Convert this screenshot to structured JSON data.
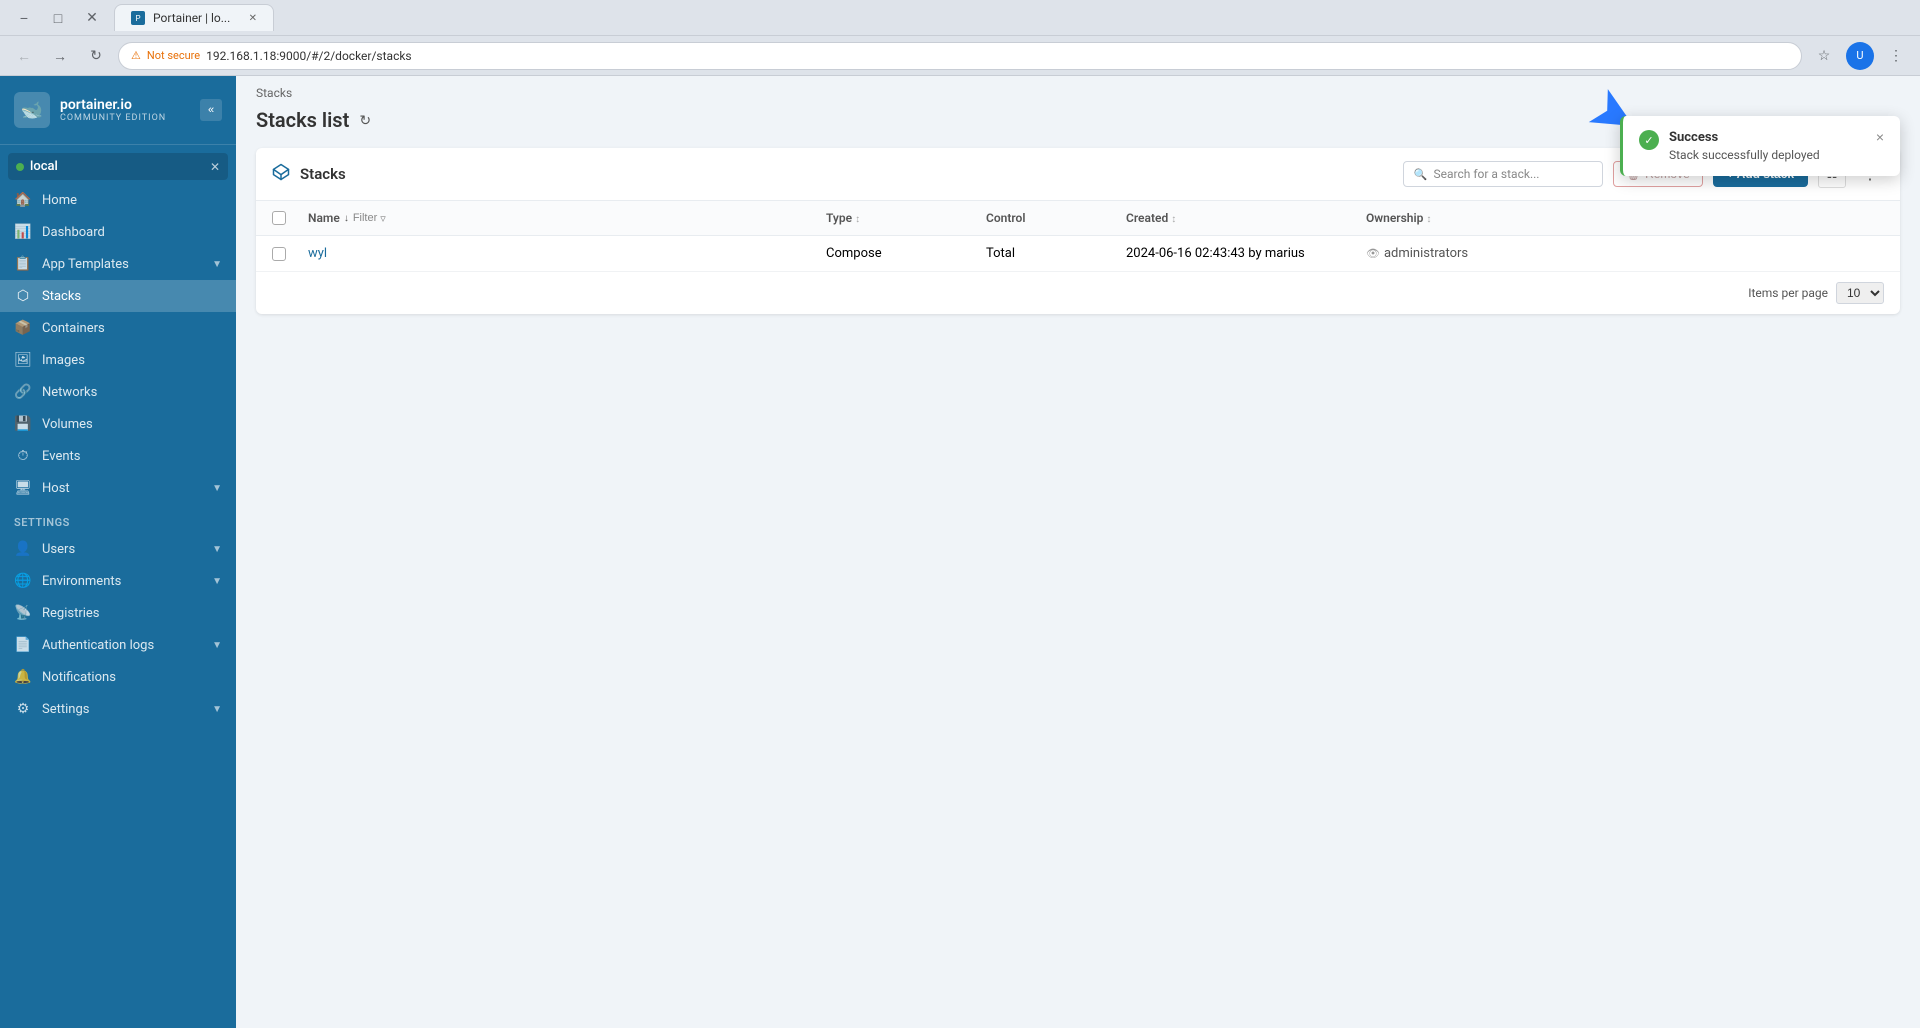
{
  "browser": {
    "tab_title": "Portainer | lo...",
    "tab_favicon": "P",
    "url": "192.168.1.18:9000/#/2/docker/stacks",
    "secure_label": "Not secure"
  },
  "sidebar": {
    "logo_text": "portainer.io",
    "logo_subtitle": "COMMUNITY EDITION",
    "env_name": "local",
    "nav_items": [
      {
        "icon": "🏠",
        "label": "Home"
      },
      {
        "icon": "📊",
        "label": "Dashboard"
      },
      {
        "icon": "📋",
        "label": "App Templates",
        "has_chevron": true
      },
      {
        "icon": "⬡",
        "label": "Stacks",
        "active": true
      },
      {
        "icon": "📦",
        "label": "Containers"
      },
      {
        "icon": "🖼",
        "label": "Images"
      },
      {
        "icon": "🔗",
        "label": "Networks"
      },
      {
        "icon": "💾",
        "label": "Volumes"
      },
      {
        "icon": "⏱",
        "label": "Events"
      },
      {
        "icon": "🖥",
        "label": "Host",
        "has_chevron": true
      }
    ],
    "settings_label": "Settings",
    "settings_items": [
      {
        "icon": "👤",
        "label": "Users",
        "has_chevron": true
      },
      {
        "icon": "🌐",
        "label": "Environments",
        "has_chevron": true
      },
      {
        "icon": "📡",
        "label": "Registries"
      },
      {
        "icon": "📄",
        "label": "Authentication logs",
        "has_chevron": true
      },
      {
        "icon": "🔔",
        "label": "Notifications"
      },
      {
        "icon": "⚙",
        "label": "Settings",
        "has_chevron": true
      }
    ]
  },
  "main": {
    "breadcrumb": "Stacks",
    "page_title": "Stacks list",
    "panel": {
      "title": "Stacks",
      "search_placeholder": "Search for a stack...",
      "remove_label": "Remove",
      "add_stack_label": "+ Add stack",
      "table": {
        "columns": [
          "Name",
          "Type",
          "Control",
          "Created",
          "Ownership"
        ],
        "rows": [
          {
            "name": "wyl",
            "type": "Compose",
            "control": "Total",
            "created": "2024-06-16 02:43:43 by marius",
            "ownership": "administrators"
          }
        ],
        "items_per_page_label": "Items per page",
        "items_per_page_value": "10"
      }
    }
  },
  "toast": {
    "title": "Success",
    "message": "Stack successfully deployed",
    "close_label": "×"
  }
}
